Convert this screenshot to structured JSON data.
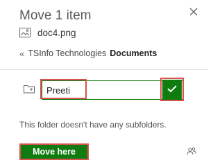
{
  "dialog": {
    "title": "Move 1 item",
    "file_name": "doc4.png"
  },
  "breadcrumb": {
    "separator": "«",
    "parent": "TSInfo Technologies",
    "current": "Documents"
  },
  "new_folder": {
    "value": "Preeti"
  },
  "empty_message": "This folder doesn't have any subfolders.",
  "actions": {
    "move_label": "Move here"
  },
  "colors": {
    "accent": "#107c10",
    "highlight": "#d9534f"
  },
  "icons": {
    "close": "close-icon",
    "file": "image-file-icon",
    "folder": "new-folder-icon",
    "confirm": "checkmark-icon",
    "people": "people-icon"
  }
}
